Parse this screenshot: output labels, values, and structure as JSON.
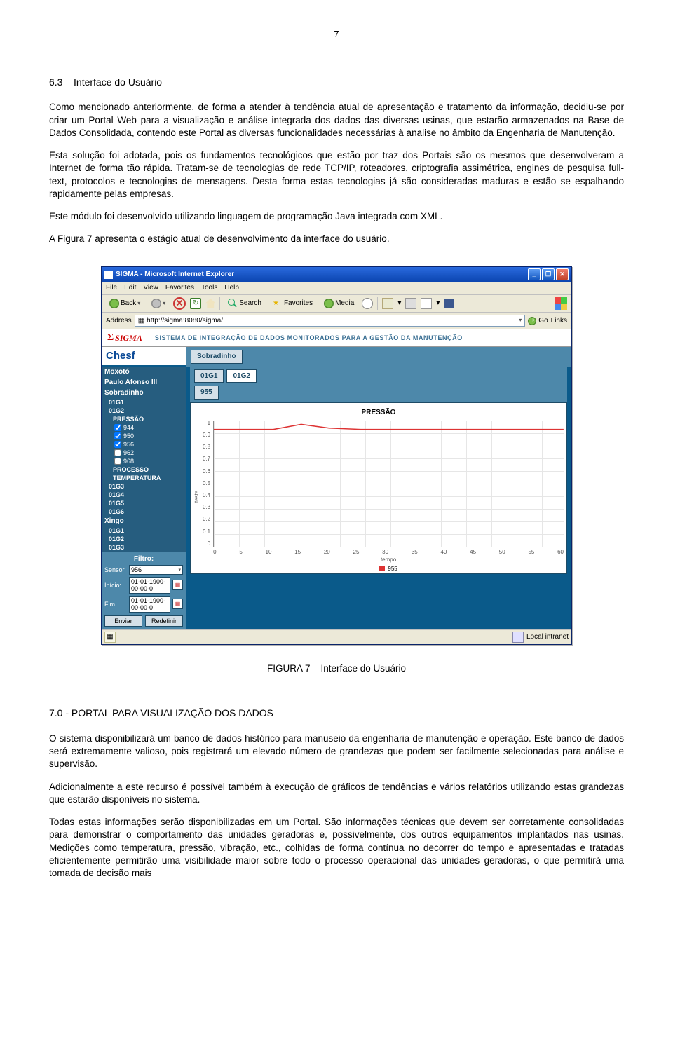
{
  "pageNumber": "7",
  "heading63": "6.3 – Interface do Usuário",
  "para1": "Como mencionado anteriormente, de forma a atender à tendência atual de apresentação e tratamento da informação, decidiu-se por criar um Portal Web para a visualização e análise integrada dos dados das diversas usinas, que estarão armazenados na Base de Dados Consolidada, contendo este Portal as diversas funcionalidades necessárias à analise no âmbito da Engenharia de Manutenção.",
  "para2": "Esta solução foi adotada, pois os fundamentos tecnológicos que estão por traz dos Portais são os mesmos que desenvolveram a Internet de forma tão rápida. Tratam-se de tecnologias de rede TCP/IP, roteadores, criptografia assimétrica, engines de pesquisa full-text, protocolos e tecnologias de mensagens. Desta forma estas tecnologias já são consideradas maduras e estão se espalhando rapidamente pelas empresas.",
  "para3": "Este módulo foi desenvolvido utilizando linguagem de programação Java integrada com XML.",
  "para4": "A Figura 7 apresenta o estágio atual de desenvolvimento da interface do usuário.",
  "caption": "FIGURA 7 – Interface do Usuário",
  "heading70": "7.0 - PORTAL PARA VISUALIZAÇÃO DOS DADOS",
  "para5": "O sistema disponibilizará um banco de dados histórico para manuseio da engenharia de manutenção e operação. Este banco de dados será extremamente valioso, pois registrará um elevado número de grandezas que podem ser facilmente selecionadas para análise e supervisão.",
  "para6": "Adicionalmente a este recurso é possível também à execução de gráficos de tendências e vários relatórios utilizando estas grandezas que estarão disponíveis no sistema.",
  "para7": "Todas estas informações serão disponibilizadas em um Portal. São informações técnicas que devem ser corretamente consolidadas para demonstrar o comportamento das unidades geradoras e, possivelmente, dos outros equipamentos implantados nas usinas. Medições como temperatura, pressão, vibração, etc., colhidas de forma contínua no decorrer do tempo e apresentadas e tratadas eficientemente permitirão uma visibilidade maior sobre todo o processo operacional das unidades geradoras, o que permitirá uma tomada de decisão mais",
  "shot": {
    "title": "SIGMA - Microsoft Internet Explorer",
    "menus": [
      "File",
      "Edit",
      "View",
      "Favorites",
      "Tools",
      "Help"
    ],
    "toolbar": {
      "back": "Back",
      "search": "Search",
      "favorites": "Favorites",
      "media": "Media"
    },
    "address": {
      "label": "Address",
      "url": "http://sigma:8080/sigma/",
      "go": "Go",
      "links": "Links"
    },
    "brand": {
      "sigma": "SIGMA",
      "subtitle": "SISTEMA DE INTEGRAÇÃO DE DADOS MONITORADOS PARA A GESTÃO DA MANUTENÇÃO",
      "chesf": "Chesf"
    },
    "sidebar": {
      "areas": [
        "Moxotó",
        "Paulo Afonso III",
        "Sobradinho"
      ],
      "units": [
        "01G1",
        "01G2"
      ],
      "measures": [
        "PRESSÃO",
        "PROCESSO",
        "TEMPERATURA"
      ],
      "sensorsChecked": [
        "944",
        "950",
        "956"
      ],
      "sensorsUnchecked": [
        "962",
        "968"
      ],
      "units2": [
        "01G3",
        "01G4",
        "01G5",
        "01G6"
      ],
      "area4": "Xingo",
      "units3": [
        "01G1",
        "01G2",
        "01G3"
      ]
    },
    "filter": {
      "title": "Filtro:",
      "sensor": "Sensor",
      "sensorVal": "956",
      "inicio": "Início:",
      "inicioVal": "01-01-1900-00-00-0",
      "fim": "Fim",
      "fimVal": "01-01-1900-00-00-0",
      "enviar": "Enviar",
      "redefinir": "Redefinir"
    },
    "tabs": {
      "sob": "Sobradinho",
      "g1": "01G1",
      "g2": "01G2",
      "s955": "955"
    },
    "status": {
      "zone": "Local intranet"
    }
  },
  "chart_data": {
    "type": "line",
    "title": "PRESSÃO",
    "xlabel": "tempo",
    "ylabel": "teste",
    "x": [
      0,
      5,
      10,
      15,
      20,
      25,
      30,
      35,
      40,
      45,
      50,
      55,
      60
    ],
    "ylim": [
      0.0,
      1.0
    ],
    "yticks": [
      0.0,
      0.1,
      0.2,
      0.3,
      0.4,
      0.5,
      0.6,
      0.7,
      0.8,
      0.9,
      1.0
    ],
    "series": [
      {
        "name": "955",
        "color": "#d33",
        "values": [
          0.93,
          0.93,
          0.93,
          0.97,
          0.94,
          0.93,
          0.93,
          0.93,
          0.93,
          0.93,
          0.93,
          0.93,
          0.93
        ]
      }
    ]
  }
}
